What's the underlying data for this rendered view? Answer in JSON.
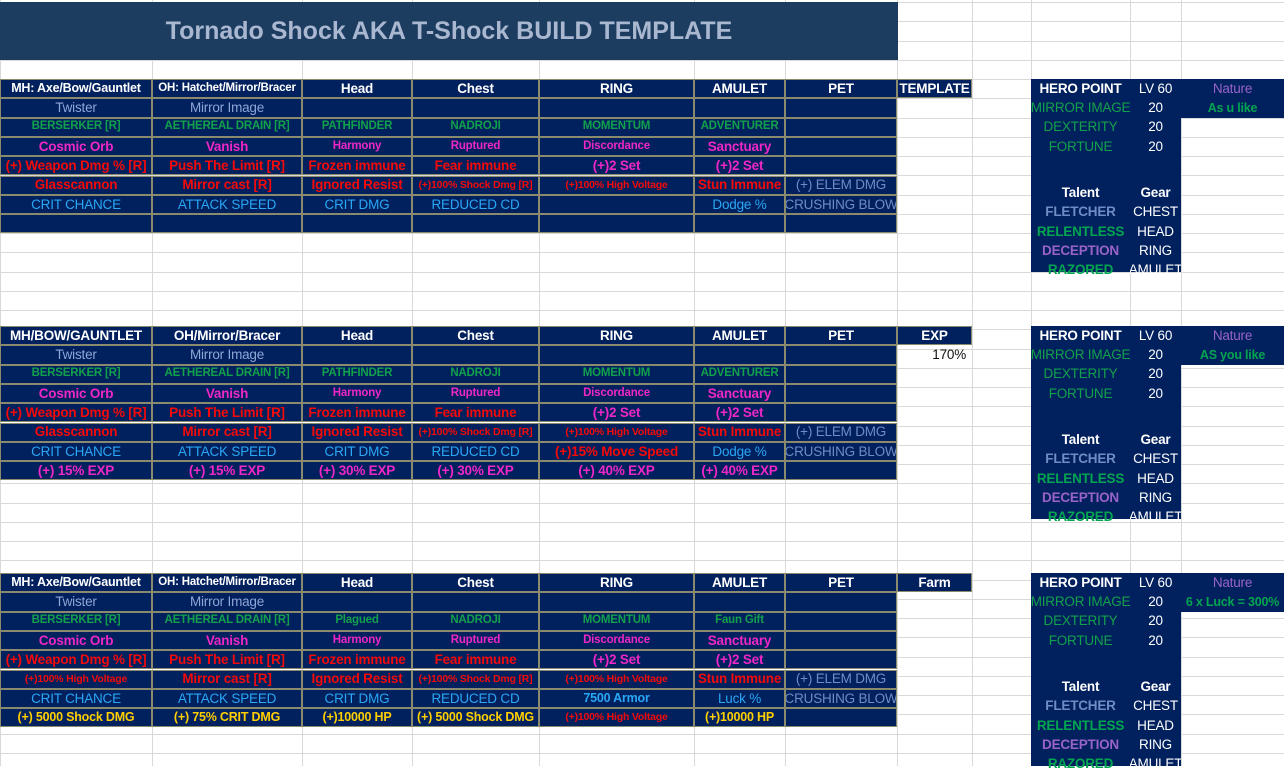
{
  "title": "Tornado Shock AKA T-Shock BUILD TEMPLATE",
  "columns": [
    "MH",
    "OH",
    "Head",
    "Chest",
    "RING",
    "AMULET",
    "PET"
  ],
  "tables": [
    {
      "tag": "TEMPLATE",
      "tag_value": "",
      "headers": [
        "MH: Axe/Bow/Gauntlet",
        "OH:  Hatchet/Mirror/Bracer",
        "Head",
        "Chest",
        "RING",
        "AMULET",
        "PET"
      ],
      "rows": [
        [
          "Twister",
          "Mirror Image",
          "",
          "",
          "",
          "",
          ""
        ],
        [
          "BERSERKER [R]",
          "AETHEREAL DRAIN [R]",
          "PATHFINDER",
          "NADROJI",
          "MOMENTUM",
          "ADVENTURER",
          ""
        ],
        [
          "Cosmic Orb",
          "Vanish",
          "Harmony",
          "Ruptured",
          "Discordance",
          "Sanctuary",
          ""
        ],
        [
          "(+) Weapon Dmg % [R]",
          "Push The Limit [R]",
          "Frozen immune",
          "Fear immune",
          "(+)2 Set",
          "(+)2 Set",
          ""
        ],
        [
          "Glasscannon",
          "Mirror cast [R]",
          "Ignored Resist",
          "(+)100% Shock Dmg [R]",
          "(+)100% High Voltage",
          "Stun Immune",
          "(+) ELEM DMG"
        ],
        [
          "CRIT CHANCE",
          "ATTACK SPEED",
          "CRIT DMG",
          "REDUCED CD",
          "",
          "Dodge %",
          "CRUSHING BLOW"
        ],
        [
          "",
          "",
          "",
          "",
          "",
          "",
          ""
        ]
      ],
      "hero": {
        "title": "HERO POINT",
        "level_label": "LV 60",
        "nature_label": "Nature",
        "nature_value": "As u like",
        "points": [
          {
            "name": "MIRROR IMAGE",
            "value": "20"
          },
          {
            "name": "DEXTERITY",
            "value": "20"
          },
          {
            "name": "FORTUNE",
            "value": "20"
          }
        ],
        "talent_label": "Talent",
        "gear_label": "Gear",
        "talents": [
          {
            "name": "FLETCHER",
            "gear": "CHEST"
          },
          {
            "name": "RELENTLESS",
            "gear": "HEAD"
          },
          {
            "name": "DECEPTION",
            "gear": "RING"
          },
          {
            "name": "RAZORED",
            "gear": "AMULET"
          }
        ]
      }
    },
    {
      "tag": "EXP",
      "tag_value": "170%",
      "headers": [
        "MH/BOW/GAUNTLET",
        "OH/Mirror/Bracer",
        "Head",
        "Chest",
        "RING",
        "AMULET",
        "PET"
      ],
      "rows": [
        [
          "Twister",
          "Mirror Image",
          "",
          "",
          "",
          "",
          ""
        ],
        [
          "BERSERKER [R]",
          "AETHEREAL DRAIN [R]",
          "PATHFINDER",
          "NADROJI",
          "MOMENTUM",
          "ADVENTURER",
          ""
        ],
        [
          "Cosmic Orb",
          "Vanish",
          "Harmony",
          "Ruptured",
          "Discordance",
          "Sanctuary",
          ""
        ],
        [
          "(+) Weapon Dmg % [R]",
          "Push The Limit [R]",
          "Frozen immune",
          "Fear immune",
          "(+)2 Set",
          "(+)2 Set",
          ""
        ],
        [
          "Glasscannon",
          "Mirror cast [R]",
          "Ignored Resist",
          "(+)100% Shock Dmg [R]",
          "(+)100% High Voltage",
          "Stun Immune",
          "(+) ELEM DMG"
        ],
        [
          "CRIT CHANCE",
          "ATTACK SPEED",
          "CRIT DMG",
          "REDUCED CD",
          "(+)15% Move Speed",
          "Dodge %",
          "CRUSHING BLOW"
        ],
        [
          "(+) 15% EXP",
          "(+) 15% EXP",
          "(+) 30% EXP",
          "(+) 30% EXP",
          "(+) 40% EXP",
          "(+) 40% EXP",
          ""
        ]
      ],
      "hero": {
        "title": "HERO POINT",
        "level_label": "LV 60",
        "nature_label": "Nature",
        "nature_value": "AS you like",
        "points": [
          {
            "name": "MIRROR IMAGE",
            "value": "20"
          },
          {
            "name": "DEXTERITY",
            "value": "20"
          },
          {
            "name": "FORTUNE",
            "value": "20"
          }
        ],
        "talent_label": "Talent",
        "gear_label": "Gear",
        "talents": [
          {
            "name": "FLETCHER",
            "gear": "CHEST"
          },
          {
            "name": "RELENTLESS",
            "gear": "HEAD"
          },
          {
            "name": "DECEPTION",
            "gear": "RING"
          },
          {
            "name": "RAZORED",
            "gear": "AMULET"
          }
        ]
      }
    },
    {
      "tag": "Farm",
      "tag_value": "",
      "headers": [
        "MH: Axe/Bow/Gauntlet",
        "OH:  Hatchet/Mirror/Bracer",
        "Head",
        "Chest",
        "RING",
        "AMULET",
        "PET"
      ],
      "rows": [
        [
          "Twister",
          "Mirror Image",
          "",
          "",
          "",
          "",
          ""
        ],
        [
          "BERSERKER [R]",
          "AETHEREAL DRAIN [R]",
          "Plagued",
          "NADROJI",
          "MOMENTUM",
          "Faun Gift",
          ""
        ],
        [
          "Cosmic Orb",
          "Vanish",
          "Harmony",
          "Ruptured",
          "Discordance",
          "Sanctuary",
          ""
        ],
        [
          "(+) Weapon Dmg % [R]",
          "Push The Limit [R]",
          "Frozen immune",
          "Fear immune",
          "(+)2 Set",
          "(+)2 Set",
          ""
        ],
        [
          "(+)100% High Voltage",
          "Mirror cast [R]",
          "Ignored Resist",
          "(+)100% Shock Dmg [R]",
          "(+)100% High Voltage",
          "Stun Immune",
          "(+) ELEM DMG"
        ],
        [
          "CRIT CHANCE",
          "ATTACK SPEED",
          "CRIT DMG",
          "REDUCED CD",
          "7500 Armor",
          "Luck %",
          "CRUSHING BLOW"
        ],
        [
          "(+) 5000  Shock DMG",
          "(+) 75% CRIT DMG",
          "(+)10000 HP",
          "(+) 5000  Shock DMG",
          "(+)100% High Voltage",
          "(+)10000 HP",
          ""
        ]
      ],
      "hero": {
        "title": "HERO POINT",
        "level_label": "LV 60",
        "nature_label": "Nature",
        "nature_value": "6 x Luck = 300%",
        "points": [
          {
            "name": "MIRROR IMAGE",
            "value": "20"
          },
          {
            "name": "DEXTERITY",
            "value": "20"
          },
          {
            "name": "FORTUNE",
            "value": "20"
          }
        ],
        "talent_label": "Talent",
        "gear_label": "Gear",
        "talents": [
          {
            "name": "FLETCHER",
            "gear": "CHEST"
          },
          {
            "name": "RELENTLESS",
            "gear": "HEAD"
          },
          {
            "name": "DECEPTION",
            "gear": "RING"
          },
          {
            "name": "RAZORED",
            "gear": "AMULET"
          }
        ]
      }
    }
  ],
  "colors": {
    "title_bar": "#1c3c60",
    "table_bg": "#00205e",
    "white": "#ffffff",
    "steel": "#8fa6d8",
    "green": "#12a14b",
    "magenta": "#ef27c6",
    "red": "#f50a0a",
    "cyan": "#2aa7f5",
    "yellow": "#ffcf00",
    "purple": "#9a63c9",
    "steelblue": "#6f8cc4"
  }
}
